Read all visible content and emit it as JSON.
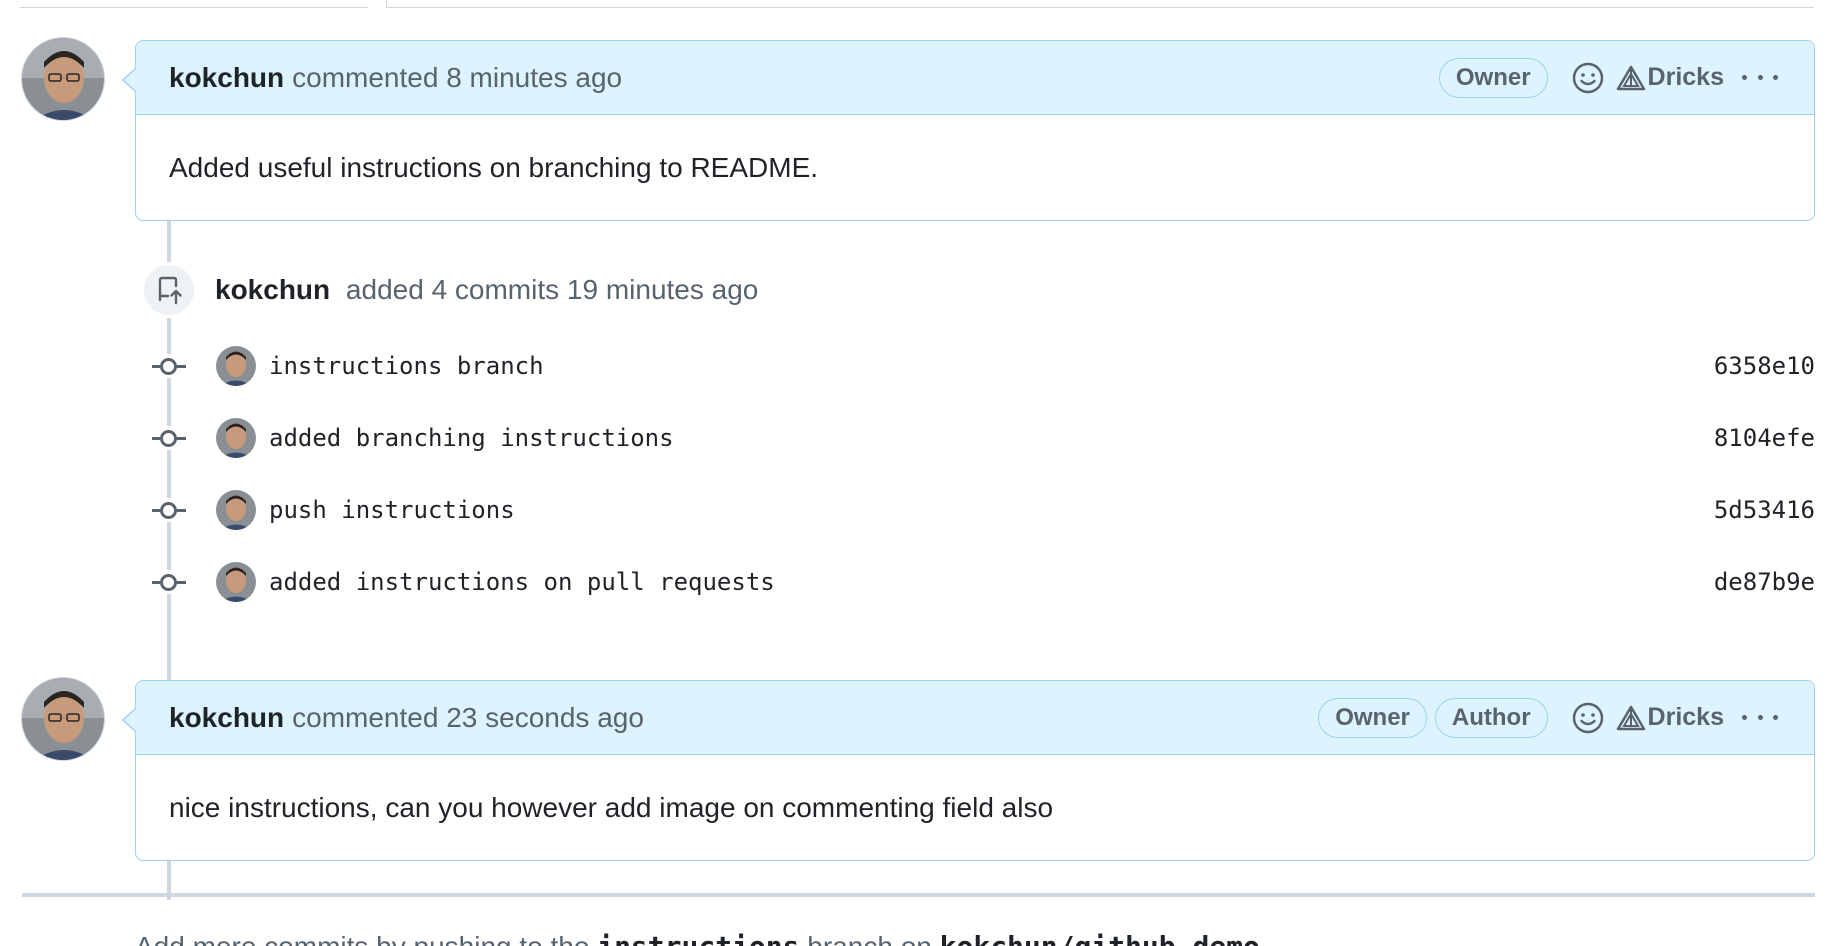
{
  "comments": [
    {
      "author": "kokchun",
      "action": "commented 8 minutes ago",
      "badges": [
        "Owner"
      ],
      "reaction_label": "Dricks",
      "body": "Added useful instructions on branching to README."
    },
    {
      "author": "kokchun",
      "action": "commented 23 seconds ago",
      "badges": [
        "Owner",
        "Author"
      ],
      "reaction_label": "Dricks",
      "body": "nice instructions, can you however add image on commenting field also"
    }
  ],
  "push_event": {
    "author": "kokchun",
    "text": "added 4 commits 19 minutes ago"
  },
  "commits": [
    {
      "message": "instructions branch",
      "sha": "6358e10"
    },
    {
      "message": "added branching instructions",
      "sha": "8104efe"
    },
    {
      "message": "push instructions",
      "sha": "5d53416"
    },
    {
      "message": "added instructions on pull requests",
      "sha": "de87b9e"
    }
  ],
  "icons": {
    "reaction": "smiley-icon",
    "dricks": "triangle-logo-icon",
    "more": "kebab-horizontal-icon",
    "push": "repo-push-icon",
    "commit": "git-commit-icon"
  },
  "colors": {
    "header_bg": "#ddf4ff",
    "header_border": "#9cd1f3",
    "muted_text": "#59636e",
    "timeline": "#d0d7de"
  },
  "footer": {
    "text_a": "Add more commits by pushing to the ",
    "branch": "instructions",
    "text_b": " branch on ",
    "repo": "kokchun/github-demo"
  }
}
